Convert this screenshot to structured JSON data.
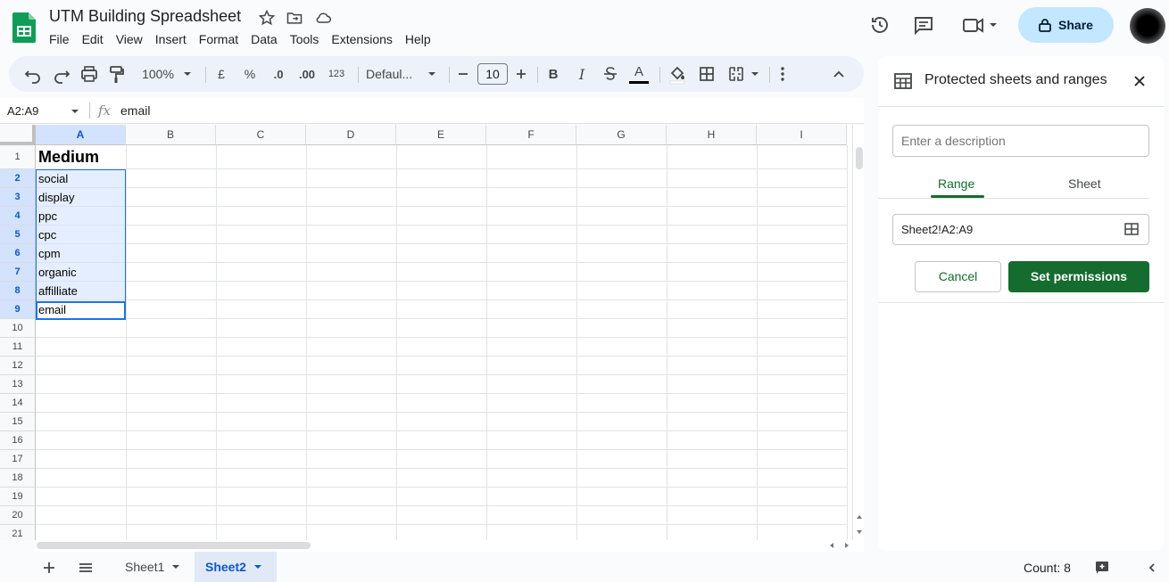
{
  "app": {
    "doc_title": "UTM Building Spreadsheet",
    "menu": [
      "File",
      "Edit",
      "View",
      "Insert",
      "Format",
      "Data",
      "Tools",
      "Extensions",
      "Help"
    ],
    "share_label": "Share"
  },
  "toolbar": {
    "zoom": "100%",
    "currency": "£",
    "percent": "%",
    "dec_decrease": ".0",
    "dec_increase": ".00",
    "number_format": "123",
    "font": "Defaul...",
    "font_size": "10",
    "bold": "B",
    "italic": "I",
    "text_color": "A"
  },
  "formula_bar": {
    "name_box": "A2:A9",
    "fx": "fx",
    "content": "email"
  },
  "grid": {
    "columns": [
      "A",
      "B",
      "C",
      "D",
      "E",
      "F",
      "G",
      "H",
      "I"
    ],
    "rows": [
      "1",
      "2",
      "3",
      "4",
      "5",
      "6",
      "7",
      "8",
      "9",
      "10",
      "11",
      "12",
      "13",
      "14",
      "15",
      "16",
      "17",
      "18",
      "19",
      "20",
      "21"
    ],
    "cells_a": [
      "Medium",
      "social",
      "display",
      "ppc",
      "cpc",
      "cpm",
      "organic",
      "affilliate",
      "email"
    ]
  },
  "sheets": {
    "tabs": [
      "Sheet1",
      "Sheet2"
    ],
    "active": "Sheet2",
    "count": "Count: 8"
  },
  "panel": {
    "title": "Protected sheets and ranges",
    "description_placeholder": "Enter a description",
    "tab_range": "Range",
    "tab_sheet": "Sheet",
    "range_value": "Sheet2!A2:A9",
    "cancel_label": "Cancel",
    "set_permissions_label": "Set permissions"
  },
  "colors": {
    "accent_green": "#146c2e",
    "selection_blue": "#1a73e8",
    "share_bg": "#c2e7ff"
  }
}
